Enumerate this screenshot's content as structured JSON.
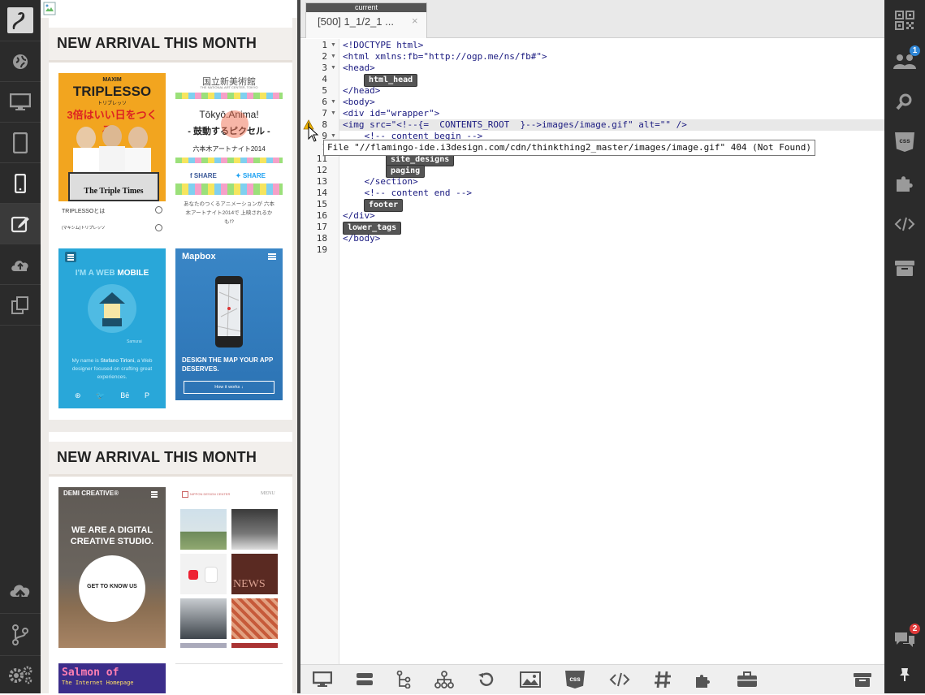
{
  "preview": {
    "section1_title": "NEW ARRIVAL THIS MONTH",
    "section2_title": "NEW ARRIVAL THIS MONTH",
    "thumbs": {
      "triplesso": {
        "brand": "MAXIM",
        "title": "TRIPLESSO",
        "sub": "トリプレッソ",
        "catch": "3倍はいい日をつくる。",
        "paper": "The Triple Times",
        "link1": "TRIPLESSOとは",
        "link2": "(マキシム)トリプレッソ"
      },
      "nact": {
        "logo": "国立新美術館",
        "logo_sub": "THE NATIONAL ART CENTER, TOKYO",
        "title": "Tōkyō.Anima!",
        "sub": "- 鼓動するピクセル -",
        "event": "六本木アートナイト2014",
        "share1": "SHARE",
        "share2": "SHARE",
        "note": "あなたのつくるアニメーションが 六本木アートナイト2014で 上映されるかも!?"
      },
      "samurai": {
        "headline_a": "I'M A WEB ",
        "headline_b": "MOBILE",
        "caption": "Samurai",
        "text_a": "My name is ",
        "text_b": "Stefano Tirloni",
        "text_c": ", a Web designer focused on crafting great experiences.",
        "social": [
          "⊛",
          "🐦",
          "Bē",
          "P"
        ]
      },
      "mapbox": {
        "brand": "Mapbox",
        "tagline": "DESIGN THE MAP YOUR APP DESERVES.",
        "cta": "How it works ↓"
      },
      "demi": {
        "brand": "DEMI CREATIVE®",
        "headline": "WE ARE A DIGITAL CREATIVE STUDIO.",
        "cta": "GET TO KNOW US"
      },
      "ndc": {
        "brand": "NIPPON DESIGN CENTER",
        "menu": "MENU",
        "news": "NEWS"
      },
      "salmon": {
        "title": "Salmon of",
        "sub": "The Internet Homepage"
      }
    }
  },
  "editor": {
    "tab_badge": "current",
    "tab_title": "[500] 1_1/2_1 ...",
    "tab_close": "×",
    "lines": [
      {
        "n": "1",
        "text": "<!DOCTYPE html>"
      },
      {
        "n": "2",
        "text": "<html xmlns:fb=\"http://ogp.me/ns/fb#\">"
      },
      {
        "n": "3",
        "text": "<head>"
      },
      {
        "n": "4",
        "text": ""
      },
      {
        "n": "5",
        "text": "</head>"
      },
      {
        "n": "6",
        "text": "<body>"
      },
      {
        "n": "7",
        "text": "<div id=\"wrapper\">"
      },
      {
        "n": "8",
        "text": "<img src=\"<!--{=  CONTENTS_ROOT  }-->images/image.gif\" alt=\"\" />"
      },
      {
        "n": "9",
        "text": "    <!-- content begin -->"
      },
      {
        "n": "1",
        "text": ""
      },
      {
        "n": "11",
        "text": ""
      },
      {
        "n": "12",
        "text": ""
      },
      {
        "n": "13",
        "text": "    </section>"
      },
      {
        "n": "14",
        "text": "    <!-- content end -->"
      },
      {
        "n": "15",
        "text": ""
      },
      {
        "n": "16",
        "text": "</div>"
      },
      {
        "n": "17",
        "text": ""
      },
      {
        "n": "18",
        "text": "</body>"
      },
      {
        "n": "19",
        "text": ""
      }
    ],
    "tags": {
      "html_head": "html_head",
      "site_designs": "site_designs",
      "paging": "paging",
      "footer": "footer",
      "lower_tags": "lower_tags"
    },
    "tooltip": "File \"//flamingo-ide.i3design.com/cdn/thinkthing2_master/images/image.gif\" 404 (Not Found)",
    "bottom_css_label": "css"
  },
  "right_sidebar": {
    "team_badge": "1",
    "chat_badge": "2",
    "css_label": "css"
  },
  "colors": {
    "sidebar_bg": "#2b2b2b",
    "badge_blue": "#2f86d6",
    "badge_red": "#e03a3a",
    "warning": "#f0b400"
  }
}
